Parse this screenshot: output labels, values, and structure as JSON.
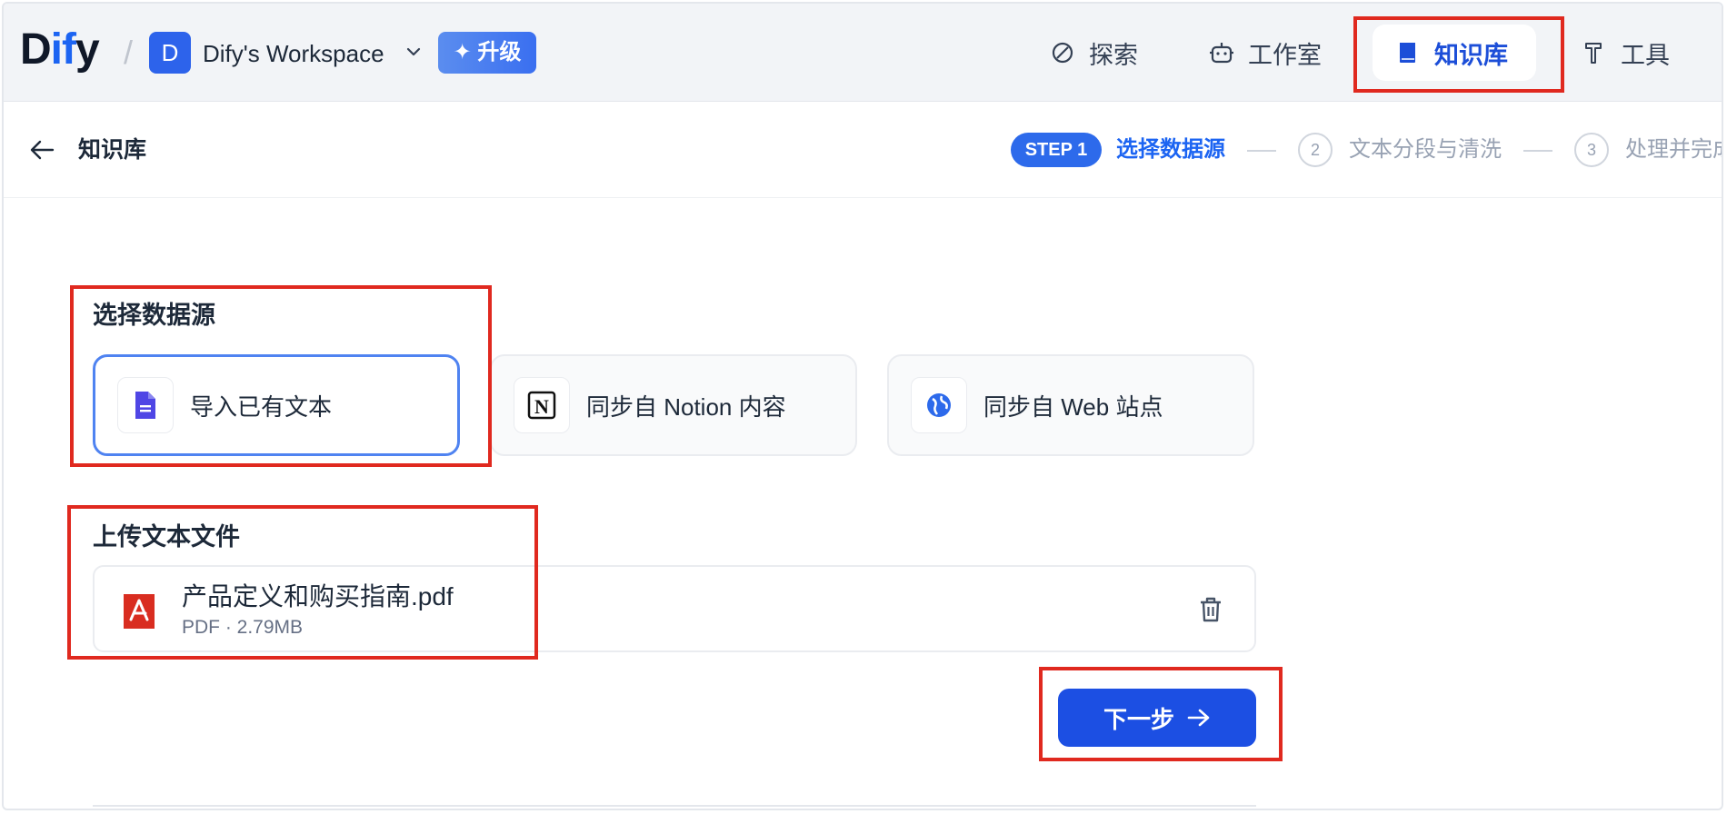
{
  "header": {
    "logo_text_1": "D",
    "logo_text_2": "if",
    "logo_text_3": "y",
    "separator": "/",
    "workspace_initial": "D",
    "workspace_name": "Dify's Workspace",
    "upgrade_label": "升级",
    "nav": [
      {
        "label": "探索",
        "icon": "compass-icon"
      },
      {
        "label": "工作室",
        "icon": "robot-icon"
      },
      {
        "label": "知识库",
        "icon": "book-icon",
        "active": true
      },
      {
        "label": "工具",
        "icon": "hammer-icon"
      }
    ]
  },
  "subheader": {
    "title": "知识库",
    "steps": [
      {
        "badge": "STEP 1",
        "label": "选择数据源",
        "active": true
      },
      {
        "num": "2",
        "label": "文本分段与清洗"
      },
      {
        "num": "3",
        "label": "处理并完成"
      }
    ]
  },
  "datasource": {
    "title": "选择数据源",
    "options": [
      {
        "label": "导入已有文本",
        "icon": "document-icon",
        "selected": true
      },
      {
        "label": "同步自 Notion 内容",
        "icon": "notion-icon"
      },
      {
        "label": "同步自 Web 站点",
        "icon": "globe-icon"
      }
    ]
  },
  "upload": {
    "title": "上传文本文件",
    "file": {
      "name": "产品定义和购买指南.pdf",
      "meta": "PDF · 2.79MB"
    }
  },
  "next_label": "下一步",
  "colors": {
    "primary": "#1c4fe3",
    "highlight": "#e0291f",
    "active_nav": "#1c4ed8"
  }
}
